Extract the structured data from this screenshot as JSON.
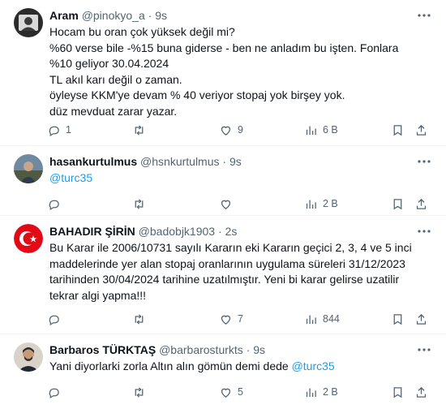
{
  "tweets": [
    {
      "name": "Aram",
      "handle": "@pinokyo_a",
      "time": "9s",
      "lines": [
        "Hocam  bu oran çok yüksek  değil mi?",
        "%60 verse bile  -%15  buna  giderse - ben ne  anladım  bu işten. Fonlara",
        "%10  geliyor  30.04.2024",
        "TL akıl karı değil o zaman.",
        "öyleyse KKM'ye  devam % 40  veriyor  stopaj yok  birşey yok.",
        "düz mevduat  zarar  yazar."
      ],
      "replies": "1",
      "retweets": "",
      "likes": "9",
      "views": "6 B"
    },
    {
      "name": "hasankurtulmus",
      "handle": "@hsnkurtulmus",
      "time": "9s",
      "mention": "@turc35",
      "replies": "",
      "retweets": "",
      "likes": "",
      "views": "2 B"
    },
    {
      "name": "BAHADIR ŞİRİN",
      "handle": "@badobjk1903",
      "time": "2s",
      "lines": [
        "Bu Karar ile 2006/10731 sayılı Kararın eki Kararın geçici 2, 3, 4 ve 5 inci",
        "maddelerinde yer alan stopaj oranlarının uygulama süreleri 31/12/2023",
        "tarihinden 30/04/2024 tarihine uzatılmıştır. Yeni bi karar gelirse uzatilir",
        "tekrar algi yapma!!!"
      ],
      "replies": "",
      "retweets": "",
      "likes": "7",
      "views": "844"
    },
    {
      "name": "Barbaros TÜRKTAŞ",
      "handle": "@barbarosturkts",
      "time": "9s",
      "text": "Yani diyorlarki zorla Altın alın gömün demi dede ",
      "mention": "@turc35",
      "replies": "",
      "retweets": "",
      "likes": "5",
      "views": "2 B"
    }
  ],
  "icons": [
    "more-icon",
    "reply-icon",
    "retweet-icon",
    "like-icon",
    "views-icon",
    "bookmark-icon",
    "share-icon"
  ],
  "colors": {
    "accent": "#1d9bf0",
    "muted": "#536471",
    "text": "#0f1419",
    "divider": "#eff3f4",
    "besiktas_red": "#e30a17"
  }
}
